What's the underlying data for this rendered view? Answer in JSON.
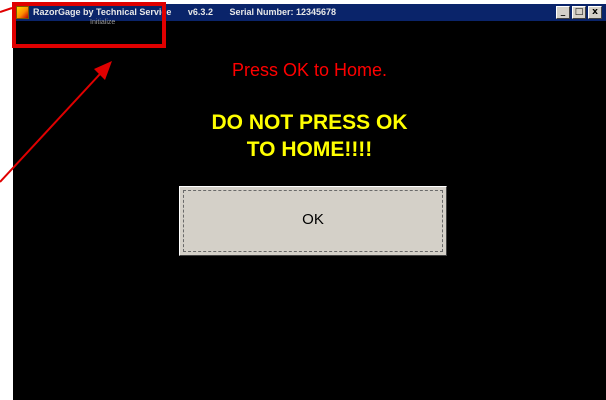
{
  "window": {
    "title_app": "RazorGage  by  Technical Service",
    "title_version": "v6.3.2",
    "title_serial": "Serial Number: 12345678",
    "controls": {
      "minimize": "_",
      "maximize": "□",
      "close": "x"
    }
  },
  "menu": {
    "initialize_label": "Initialize"
  },
  "message": {
    "home_prompt": "Press OK to Home.",
    "warning_line1": "DO NOT PRESS OK",
    "warning_line2": "TO HOME!!!!"
  },
  "buttons": {
    "ok_label": "OK"
  },
  "colors": {
    "background": "#000000",
    "prompt_text": "#ff0000",
    "warning_text": "#ffff00",
    "annotation": "#e00000",
    "titlebar": "#0a246a"
  }
}
